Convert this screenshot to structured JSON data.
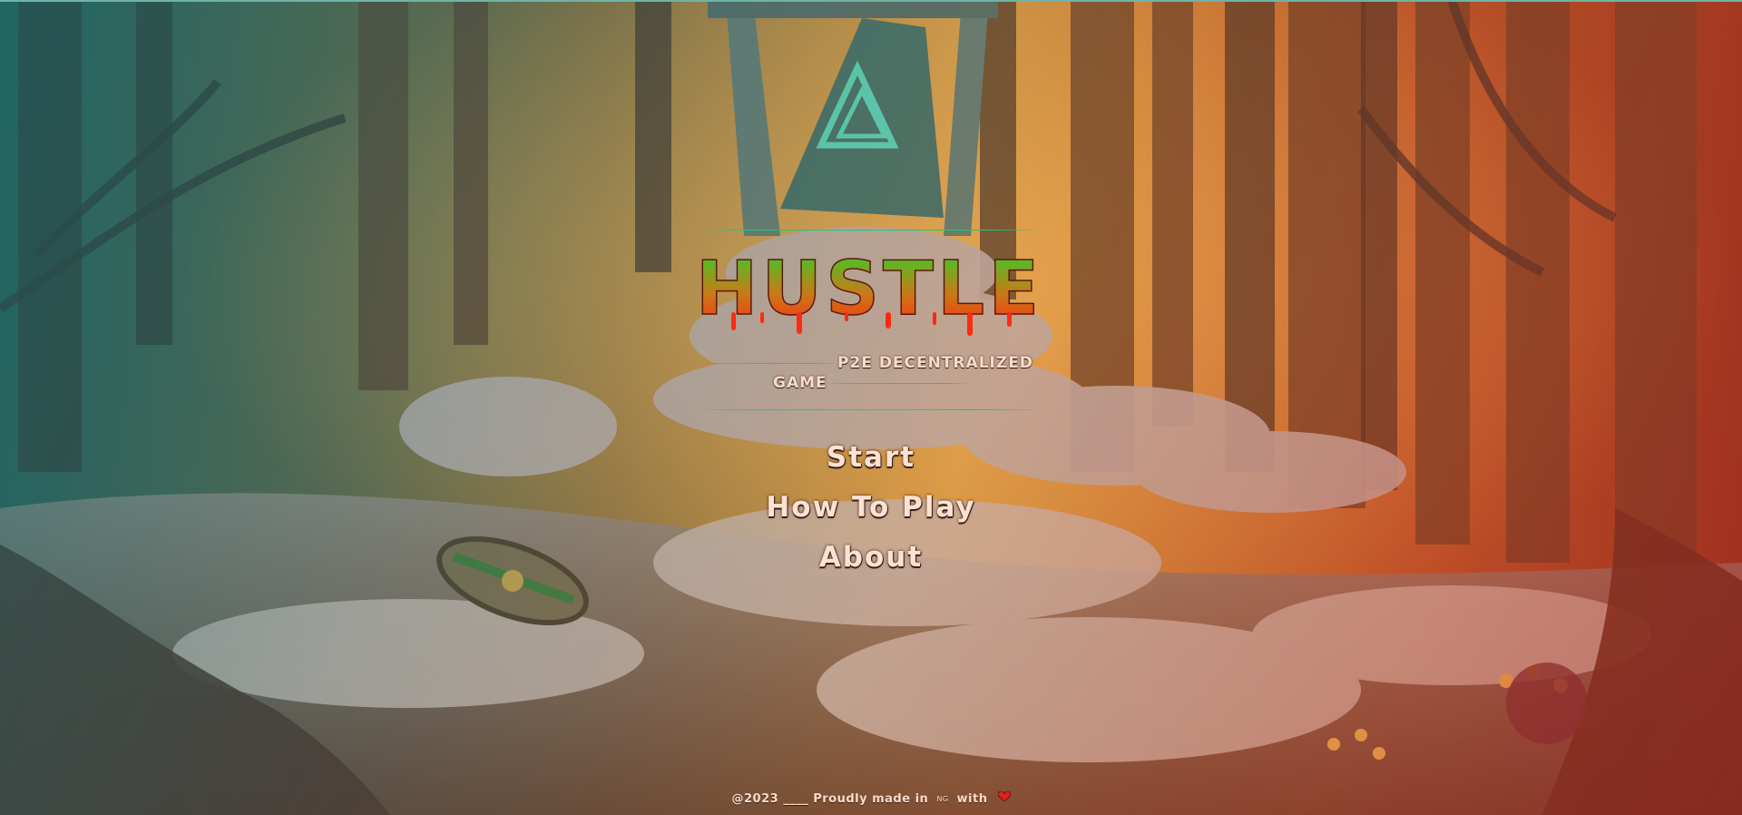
{
  "game": {
    "title": "HUSTLE",
    "subtitle_line1": "P2E DECENTRALIZED",
    "subtitle_line2": "GAME"
  },
  "menu": {
    "items": [
      {
        "label": "Start"
      },
      {
        "label": "How To Play"
      },
      {
        "label": "About"
      }
    ]
  },
  "footer": {
    "prefix": "@2023 ____ Proudly made in",
    "ng": "NG",
    "suffix": "with"
  },
  "colors": {
    "title_top": "#28d62a",
    "title_bottom": "#ff2a10",
    "accent_line": "#29c27a",
    "menu_text": "#fbe2d2",
    "heart": "#e02020"
  },
  "icons": [
    "rune-stone-icon",
    "shield-icon",
    "heart-icon"
  ]
}
